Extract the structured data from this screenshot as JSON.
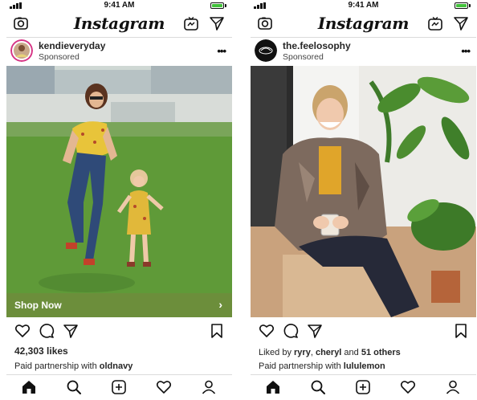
{
  "status": {
    "time": "9:41 AM"
  },
  "app": {
    "logo": "Instagram"
  },
  "posts": [
    {
      "username": "kendieveryday",
      "sponsored": "Sponsored",
      "shop_now": "Shop Now",
      "likes": "42,303 likes",
      "partner_prefix": "Paid partnership with ",
      "partner_name": "oldnavy"
    },
    {
      "username": "the.feelosophy",
      "sponsored": "Sponsored",
      "liked_prefix": "Liked by ",
      "liked_user1": "ryry",
      "liked_sep": ", ",
      "liked_user2": "cheryl",
      "liked_and": " and ",
      "liked_others": "51 others",
      "partner_prefix": "Paid partnership with ",
      "partner_name": "lululemon"
    }
  ],
  "icons": {
    "header_left": "camera-icon",
    "header_tv": "igtv-icon",
    "header_right": "direct-message-icon",
    "more": "more-options-icon",
    "like": "heart-icon",
    "comment": "comment-icon",
    "share": "share-icon",
    "save": "bookmark-icon",
    "nav": [
      "home-icon",
      "search-icon",
      "new-post-icon",
      "activity-icon",
      "profile-icon"
    ]
  },
  "colors": {
    "shop_bar": "#6e8c3c",
    "battery": "#43c23c",
    "divider": "#dbdbdb"
  }
}
